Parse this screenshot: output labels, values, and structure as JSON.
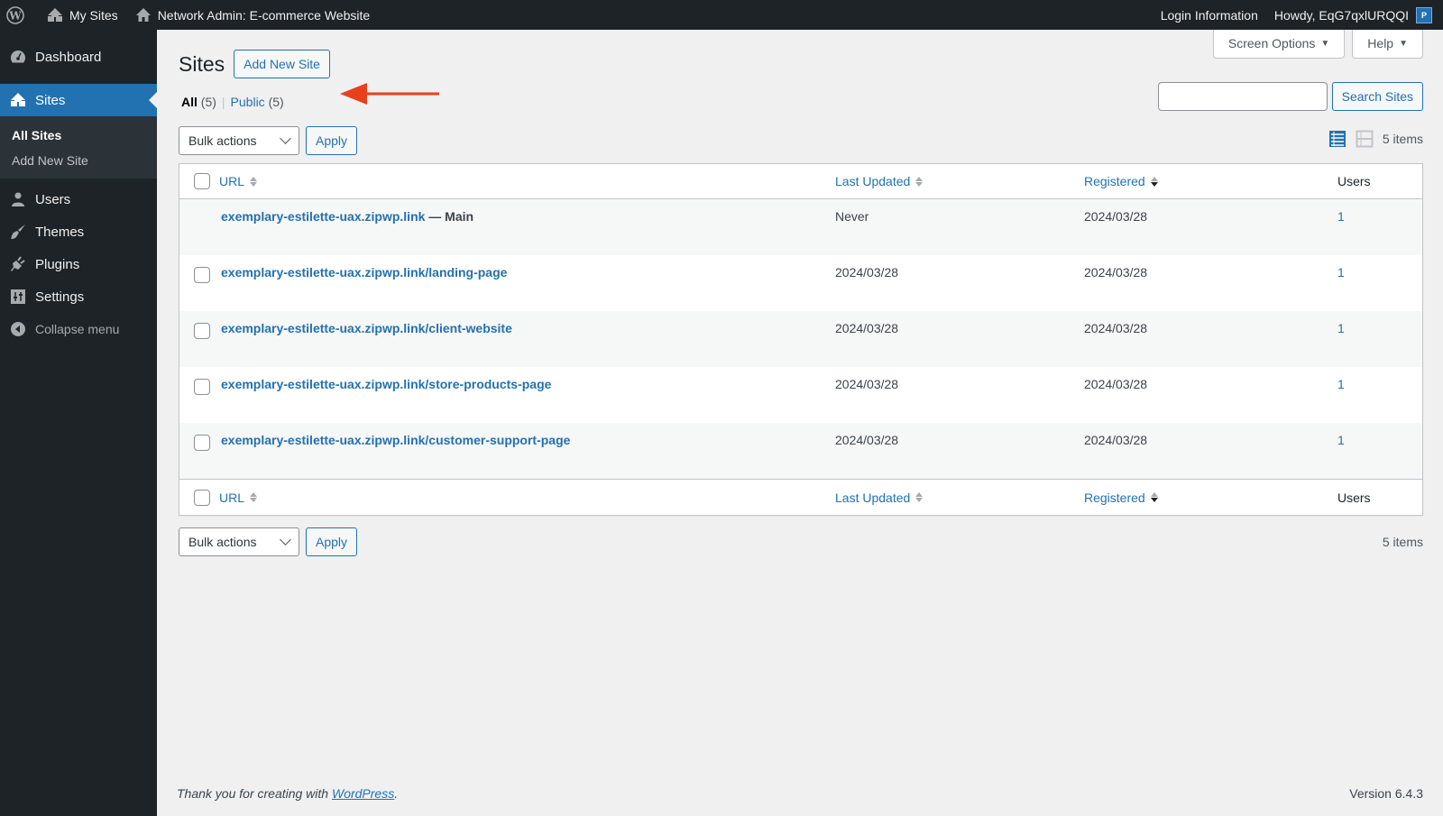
{
  "adminbar": {
    "my_sites": "My Sites",
    "network_admin": "Network Admin: E-commerce Website",
    "login_information": "Login Information",
    "howdy": "Howdy, EqG7qxlURQQI",
    "avatar_letter": "P"
  },
  "sidebar": {
    "dashboard": "Dashboard",
    "sites": "Sites",
    "submenu": [
      "All Sites",
      "Add New Site"
    ],
    "users": "Users",
    "themes": "Themes",
    "plugins": "Plugins",
    "settings": "Settings",
    "collapse": "Collapse menu"
  },
  "screen_meta": {
    "screen_options": "Screen Options",
    "help": "Help"
  },
  "page": {
    "title": "Sites",
    "add_new": "Add New Site"
  },
  "views": {
    "all_label": "All",
    "all_count": "(5)",
    "public_label": "Public",
    "public_count": "(5)",
    "separator": "|"
  },
  "search": {
    "value": "",
    "placeholder": "",
    "button": "Search Sites"
  },
  "tablenav": {
    "bulk_actions": "Bulk actions",
    "apply": "Apply",
    "items_count": "5 items"
  },
  "table": {
    "columns": {
      "url": "URL",
      "last_updated": "Last Updated",
      "registered": "Registered",
      "users": "Users"
    },
    "rows": [
      {
        "url": "exemplary-estilette-uax.zipwp.link",
        "suffix": "— Main",
        "last_updated": "Never",
        "registered": "2024/03/28",
        "users": "1"
      },
      {
        "url": "exemplary-estilette-uax.zipwp.link/landing-page",
        "suffix": "",
        "last_updated": "2024/03/28",
        "registered": "2024/03/28",
        "users": "1"
      },
      {
        "url": "exemplary-estilette-uax.zipwp.link/client-website",
        "suffix": "",
        "last_updated": "2024/03/28",
        "registered": "2024/03/28",
        "users": "1"
      },
      {
        "url": "exemplary-estilette-uax.zipwp.link/store-products-page",
        "suffix": "",
        "last_updated": "2024/03/28",
        "registered": "2024/03/28",
        "users": "1"
      },
      {
        "url": "exemplary-estilette-uax.zipwp.link/customer-support-page",
        "suffix": "",
        "last_updated": "2024/03/28",
        "registered": "2024/03/28",
        "users": "1"
      }
    ]
  },
  "footer": {
    "thanks_prefix": "Thank you for creating with ",
    "wordpress_link": "WordPress",
    "thanks_suffix": ".",
    "version": "Version 6.4.3"
  },
  "colors": {
    "accent": "#2271b1",
    "adminbar_bg": "#1d2327",
    "annotation_arrow": "#e8401c"
  }
}
